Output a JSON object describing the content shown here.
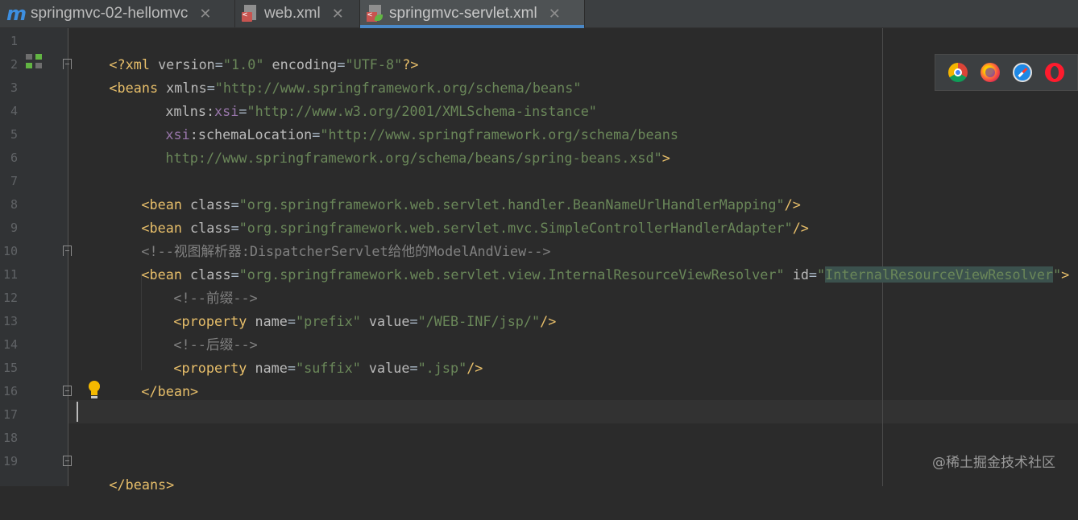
{
  "tabs": [
    {
      "label": "springmvc-02-hellomvc",
      "icon": "maven-module-icon",
      "active": false
    },
    {
      "label": "web.xml",
      "icon": "xml-file-icon",
      "active": false
    },
    {
      "label": "springmvc-servlet.xml",
      "icon": "spring-xml-file-icon",
      "active": true
    }
  ],
  "tab_close_glyph": "✕",
  "tab_m_glyph": "m",
  "tab_lt_glyph": "<",
  "line_numbers": [
    "1",
    "2",
    "3",
    "4",
    "5",
    "6",
    "7",
    "8",
    "9",
    "10",
    "11",
    "12",
    "13",
    "14",
    "15",
    "16",
    "17",
    "18",
    "19"
  ],
  "code": {
    "l1": {
      "a": "<?",
      "b": "xml ",
      "c": "version",
      "d": "=",
      "e": "\"1.0\"",
      "f": " encoding",
      "g": "=",
      "h": "\"UTF-8\"",
      "i": "?>"
    },
    "l2": {
      "a": "<beans ",
      "b": "xmlns",
      "c": "=",
      "d": "\"http://www.springframework.org/schema/beans\""
    },
    "l3": {
      "a": "xmlns:",
      "b": "xsi",
      "c": "=",
      "d": "\"http://www.w3.org/2001/XMLSchema-instance\""
    },
    "l4": {
      "a": "xsi",
      "b": ":schemaLocation",
      "c": "=",
      "d": "\"http://www.springframework.org/schema/beans"
    },
    "l5": {
      "a": "http://www.springframework.org/schema/beans/spring-beans.xsd\"",
      "b": ">"
    },
    "l7": {
      "a": "<bean ",
      "b": "class",
      "c": "=",
      "d": "\"org.springframework.web.servlet.handler.BeanNameUrlHandlerMapping\"",
      "e": "/>"
    },
    "l8": {
      "a": "<bean ",
      "b": "class",
      "c": "=",
      "d": "\"org.springframework.web.servlet.mvc.SimpleControllerHandlerAdapter\"",
      "e": "/>"
    },
    "l9": {
      "a": "<!--视图解析器:DispatcherServlet给他的ModelAndView-->"
    },
    "l10": {
      "a": "<bean ",
      "b": "class",
      "c": "=",
      "d": "\"org.springframework.web.servlet.view.InternalResourceViewResolver\"",
      "e": " id",
      "f": "=",
      "g": "\"",
      "h": "InternalResourceViewResolver",
      "i": "\"",
      "j": ">"
    },
    "l11": {
      "a": "<!--前缀-->"
    },
    "l12": {
      "a": "<property ",
      "b": "name",
      "c": "=",
      "d": "\"prefix\"",
      "e": " value",
      "f": "=",
      "g": "\"/WEB-INF/jsp/\"",
      "h": "/>"
    },
    "l13": {
      "a": "<!--后缀-->"
    },
    "l14": {
      "a": "<property ",
      "b": "name",
      "c": "=",
      "d": "\"suffix\"",
      "e": " value",
      "f": "=",
      "g": "\".jsp\"",
      "h": "/>"
    },
    "l15": {
      "a": "</bean>"
    },
    "l19": {
      "a": "</beans>"
    }
  },
  "browsers": [
    "chrome-icon",
    "firefox-icon",
    "safari-icon",
    "opera-icon"
  ],
  "watermark": "@稀土掘金技术社区",
  "colors": {
    "editor_bg": "#2b2b2b",
    "tag": "#e8bf6a",
    "attribute_value": "#6a8759",
    "namespace": "#9876aa",
    "comment": "#808080",
    "tab_underline": "#4a88c7"
  }
}
